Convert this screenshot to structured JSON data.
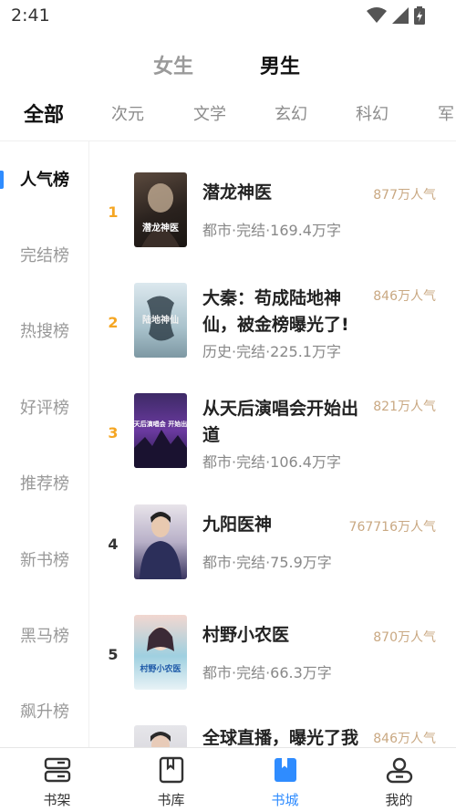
{
  "status_bar": {
    "time": "2:41"
  },
  "gender_tabs": {
    "female": "女生",
    "male": "男生"
  },
  "category_tabs": [
    "全部",
    "次元",
    "文学",
    "玄幻",
    "科幻",
    "军"
  ],
  "rank_sidebar": [
    "人气榜",
    "完结榜",
    "热搜榜",
    "好评榜",
    "推荐榜",
    "新书榜",
    "黑马榜",
    "飙升榜"
  ],
  "books": [
    {
      "rank": "1",
      "title": "潜龙神医",
      "meta": "都市·完结·169.4万字",
      "heat": "877万人气",
      "cover_text": "潜龙神医"
    },
    {
      "rank": "2",
      "title": "大秦：苟成陆地神仙，被金榜曝光了!",
      "meta": "历史·完结·225.1万字",
      "heat": "846万人气",
      "cover_text": "陆地神仙"
    },
    {
      "rank": "3",
      "title": "从天后演唱会开始出道",
      "meta": "都市·完结·106.4万字",
      "heat": "821万人气",
      "cover_text": "从天后演唱会 开始出道"
    },
    {
      "rank": "4",
      "title": "九阳医神",
      "meta": "都市·完结·75.9万字",
      "heat": "767716万人气",
      "cover_text": ""
    },
    {
      "rank": "5",
      "title": "村野小农医",
      "meta": "都市·完结·66.3万字",
      "heat": "870万人气",
      "cover_text": "村野小农医"
    },
    {
      "rank": "",
      "title": "全球直播，曝光了我",
      "meta": "",
      "heat": "846万人气",
      "cover_text": ""
    }
  ],
  "bottom_nav": [
    {
      "label": "书架",
      "icon": "bookshelf-icon"
    },
    {
      "label": "书库",
      "icon": "library-icon"
    },
    {
      "label": "书城",
      "icon": "bookstore-icon"
    },
    {
      "label": "我的",
      "icon": "profile-icon"
    }
  ],
  "colors": {
    "accent": "#2f8cff",
    "rank_top": "#f5a623",
    "heat": "#c9a882"
  }
}
